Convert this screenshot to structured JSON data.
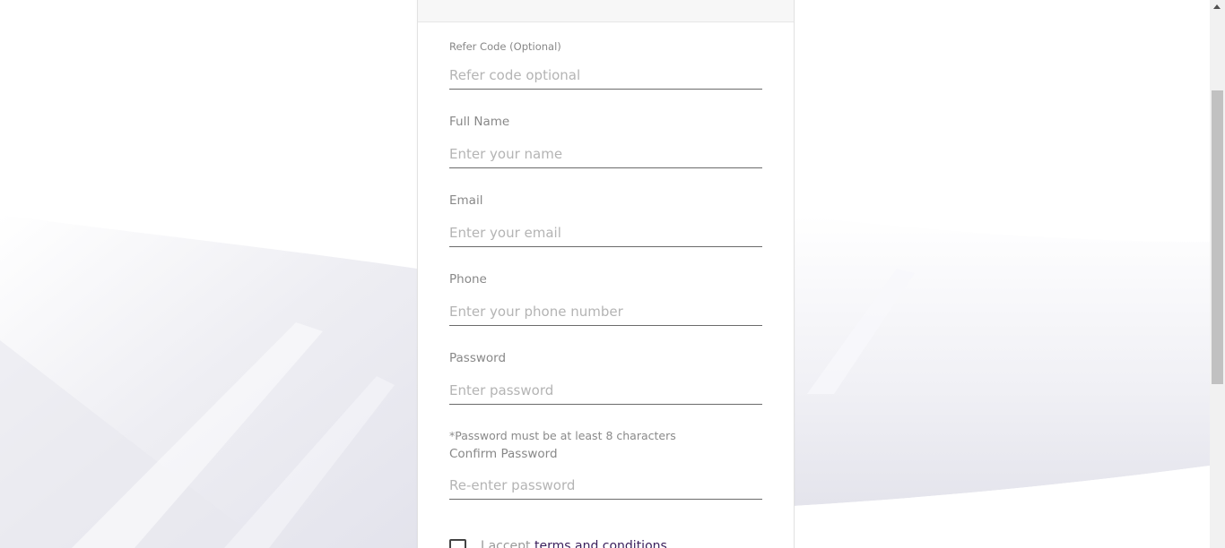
{
  "form": {
    "refer_code": {
      "label": "Refer Code (Optional)",
      "placeholder": "Refer code optional"
    },
    "full_name": {
      "label": "Full Name",
      "placeholder": "Enter your name"
    },
    "email": {
      "label": "Email",
      "placeholder": "Enter your email"
    },
    "phone": {
      "label": "Phone",
      "placeholder": "Enter your phone number"
    },
    "password": {
      "label": "Password",
      "placeholder": "Enter password",
      "hint": "*Password must be at least 8 characters"
    },
    "confirm_password": {
      "label": "Confirm Password",
      "placeholder": "Re-enter password"
    },
    "terms": {
      "prefix": "I accept ",
      "link_text": "terms and conditions",
      "checked": false
    }
  },
  "colors": {
    "label": "#888888",
    "placeholder": "#b4b4b4",
    "underline": "#6b6b6b",
    "link": "#3a1f5c"
  }
}
